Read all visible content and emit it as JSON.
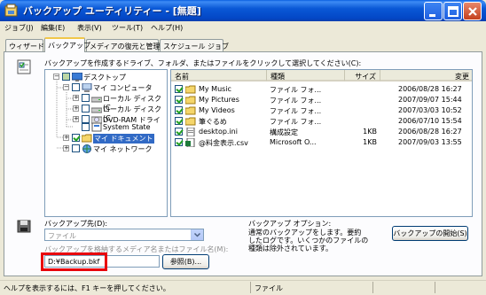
{
  "window": {
    "title": "バックアップ ユーティリティー - [無題]"
  },
  "menu": [
    "ジョブ(J)",
    "編集(E)",
    "表示(V)",
    "ツール(T)",
    "ヘルプ(H)"
  ],
  "tabs": [
    "ウィザード",
    "バックアップ",
    "メディアの復元と管理",
    "スケジュール ジョブ"
  ],
  "instruction": "バックアップを作成するドライブ、フォルダ、またはファイルをクリックして選択してください(C):",
  "tree": [
    {
      "label": "デスクトップ"
    },
    {
      "label": "マイ コンピュータ"
    },
    {
      "label": "ローカル ディスク (C"
    },
    {
      "label": "ローカル ディスク (C"
    },
    {
      "label": "DVD-RAM ドライ"
    },
    {
      "label": "System State"
    },
    {
      "label": "マイ ドキュメント"
    },
    {
      "label": "マイ ネットワーク"
    }
  ],
  "file_list": {
    "columns": [
      "名前",
      "種類",
      "サイズ",
      "変更"
    ],
    "rows": [
      {
        "name": "My Music",
        "type": "ファイル フォ...",
        "size": "",
        "modified": "2006/08/28 16:27"
      },
      {
        "name": "My Pictures",
        "type": "ファイル フォ...",
        "size": "",
        "modified": "2007/09/07 15:44"
      },
      {
        "name": "My Videos",
        "type": "ファイル フォ...",
        "size": "",
        "modified": "2007/03/03 10:52"
      },
      {
        "name": "筆ぐるめ",
        "type": "ファイル フォ...",
        "size": "",
        "modified": "2006/07/10 15:54"
      },
      {
        "name": "desktop.ini",
        "type": "構成設定",
        "size": "1KB",
        "modified": "2006/08/28 16:27"
      },
      {
        "name": "@料金表示.csv",
        "type": "Microsoft O...",
        "size": "1KB",
        "modified": "2007/09/03 13:55"
      }
    ]
  },
  "destination": {
    "label": "バックアップ先(D):",
    "value": "ファイル"
  },
  "media": {
    "label": "バックアップを格納するメディア名またはファイル名(M):",
    "value": "D:¥Backup.bkf",
    "browse_label": "参照(B)..."
  },
  "options": {
    "title": "バックアップ オプション:",
    "text1": "通常のバックアップをします。要約",
    "text2": "したログです。いくつかのファイルの",
    "text3": "種類は除外されています。"
  },
  "start_button": "バックアップの開始(S)",
  "status": {
    "left": "ヘルプを表示するには、F1 キーを押してください。",
    "middle": "ファイル"
  },
  "colors": {
    "titlebar": "#0a58d6",
    "selection": "#316ac5",
    "highlight_box": "#e8000b"
  }
}
